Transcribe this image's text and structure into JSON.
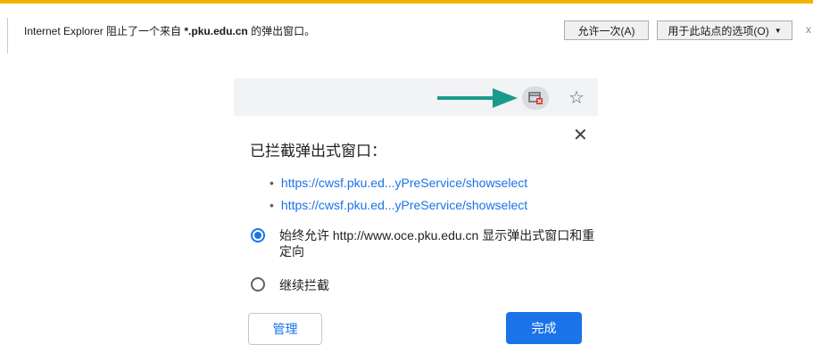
{
  "ie_bar": {
    "message_prefix": "Internet Explorer 阻止了一个来自 ",
    "domain": "*.pku.edu.cn",
    "message_suffix": " 的弹出窗口。",
    "allow_once_label": "允许一次(A)",
    "options_label": "用于此站点的选项(O)",
    "close_glyph": "x",
    "accent_color": "#f0b400"
  },
  "browser": {
    "popup_blocked_icon": "popup-blocked-icon",
    "bookmark_icon": "star-icon",
    "arrow_color": "#1a9b8a"
  },
  "dialog": {
    "title": "已拦截弹出式窗口：",
    "close_glyph": "✕",
    "links": [
      "https://cwsf.pku.ed...yPreService/showselect",
      "https://cwsf.pku.ed...yPreService/showselect"
    ],
    "options": [
      {
        "label": "始终允许 http://www.oce.pku.edu.cn 显示弹出式窗口和重定向",
        "selected": true
      },
      {
        "label": "继续拦截",
        "selected": false
      }
    ],
    "manage_label": "管理",
    "done_label": "完成",
    "accent_color": "#1a73e8"
  }
}
